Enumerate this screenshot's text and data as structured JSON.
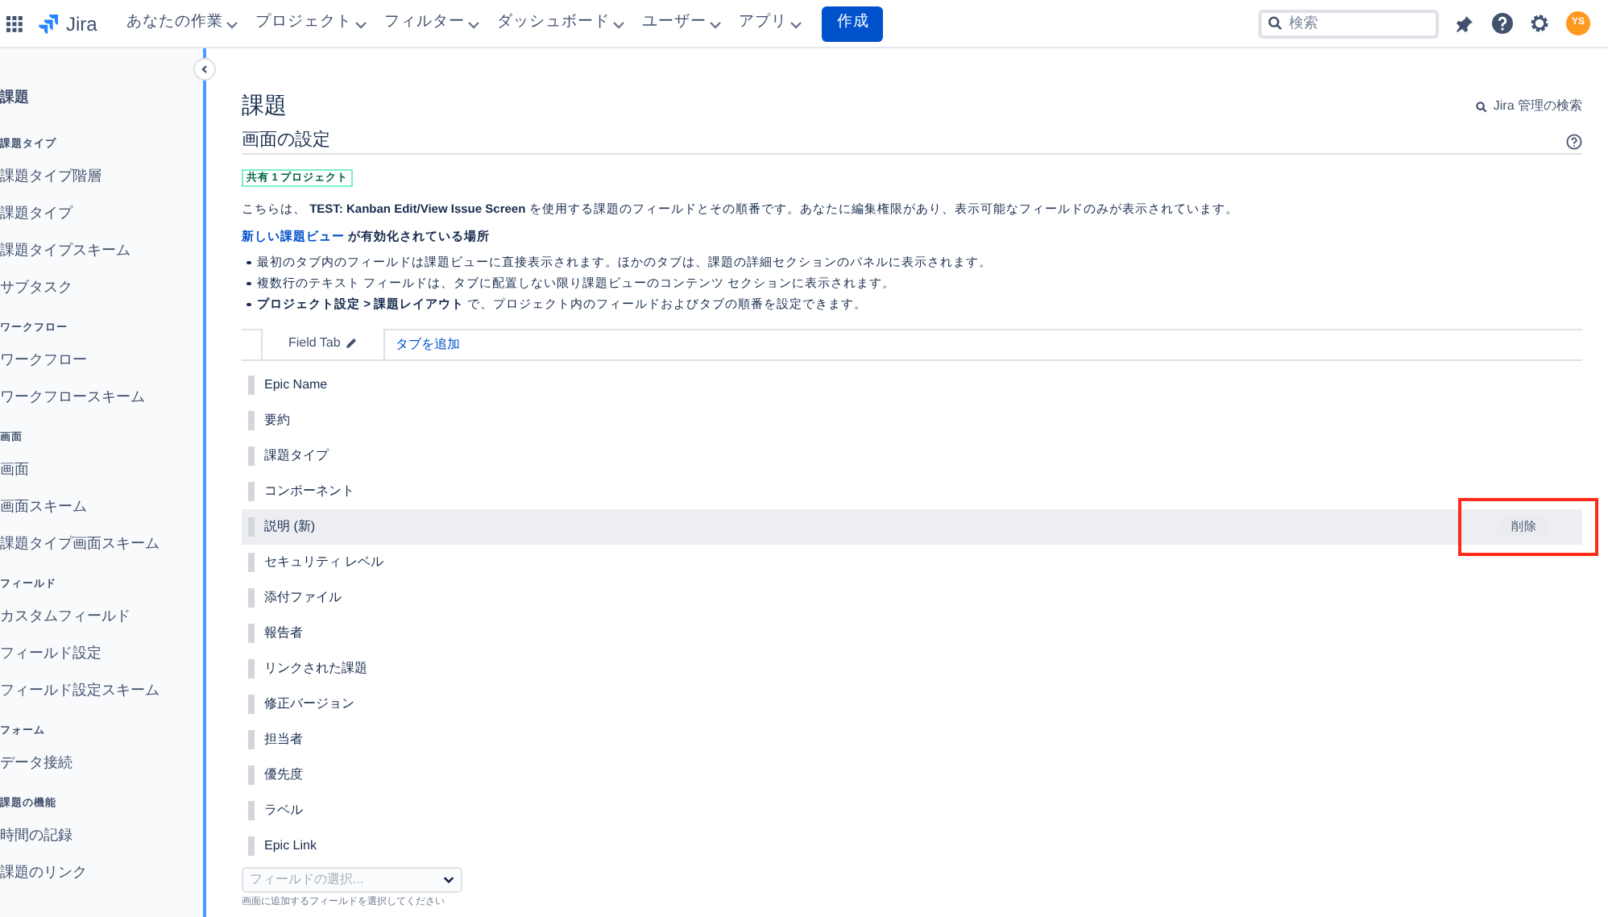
{
  "top_nav": {
    "logo": "Jira",
    "menus": [
      "あなたの作業",
      "プロジェクト",
      "フィルター",
      "ダッシュボード",
      "ユーザー",
      "アプリ"
    ],
    "create_button": "作成",
    "search": {
      "placeholder": "検索"
    },
    "avatar": "YS"
  },
  "sidebar": {
    "title": "課題",
    "sections": [
      {
        "heading": "課題タイプ",
        "items": [
          "課題タイプ階層",
          "課題タイプ",
          "課題タイプスキーム",
          "サブタスク"
        ]
      },
      {
        "heading": "ワークフロー",
        "items": [
          "ワークフロー",
          "ワークフロースキーム"
        ]
      },
      {
        "heading": "画面",
        "items": [
          "画面",
          "画面スキーム",
          "課題タイプ画面スキーム"
        ]
      },
      {
        "heading": "フィールド",
        "items": [
          "カスタムフィールド",
          "フィールド設定",
          "フィールド設定スキーム"
        ]
      },
      {
        "heading": "フォーム",
        "items": [
          "データ接続"
        ]
      },
      {
        "heading": "課題の機能",
        "items": [
          "時間の記録",
          "課題のリンク"
        ]
      }
    ]
  },
  "page": {
    "title": "課題",
    "admin_search": "Jira 管理の検索",
    "section_title": "画面の設定",
    "shared_badge": "共有 1 プロジェクト",
    "description": "こちらは、 **TEST: Kanban Edit/View Issue Screen** を使用する課題のフィールドとその順番です。あなたに編集権限があり、表示可能なフィールドのみが表示されています。",
    "new_view_link": "新しい課題ビュー",
    "new_view_text": "が有効化されている場所",
    "bullets": [
      "最初のタブ内のフィールドは課題ビューに直接表示されます。ほかのタブは、課題の詳細セクションのパネルに表示されます。",
      "複数行のテキスト フィールドは、タブに配置しない限り課題ビューのコンテンツ セクションに表示されます。",
      "**プロジェクト設定 > 課題レイアウト** で、プロジェクト内のフィールドおよびタブの順番を設定できます。"
    ],
    "tabs": [
      {
        "label": "Field Tab",
        "selected": true
      }
    ],
    "add_tab": "タブを追加",
    "fields": [
      {
        "name": "Epic Name",
        "selected": false
      },
      {
        "name": "要約",
        "selected": false
      },
      {
        "name": "課題タイプ",
        "selected": false
      },
      {
        "name": "コンポーネント",
        "selected": false
      },
      {
        "name": "説明 (新)",
        "selected": true,
        "action": "削除"
      },
      {
        "name": "セキュリティ レベル",
        "selected": false
      },
      {
        "name": "添付ファイル",
        "selected": false
      },
      {
        "name": "報告者",
        "selected": false
      },
      {
        "name": "リンクされた課題",
        "selected": false
      },
      {
        "name": "修正バージョン",
        "selected": false
      },
      {
        "name": "担当者",
        "selected": false
      },
      {
        "name": "優先度",
        "selected": false
      },
      {
        "name": "ラベル",
        "selected": false
      },
      {
        "name": "Epic Link",
        "selected": false
      }
    ],
    "field_select": {
      "placeholder": "フィールドの選択..."
    },
    "field_hint": "画面に追加するフィールドを選択してください"
  }
}
